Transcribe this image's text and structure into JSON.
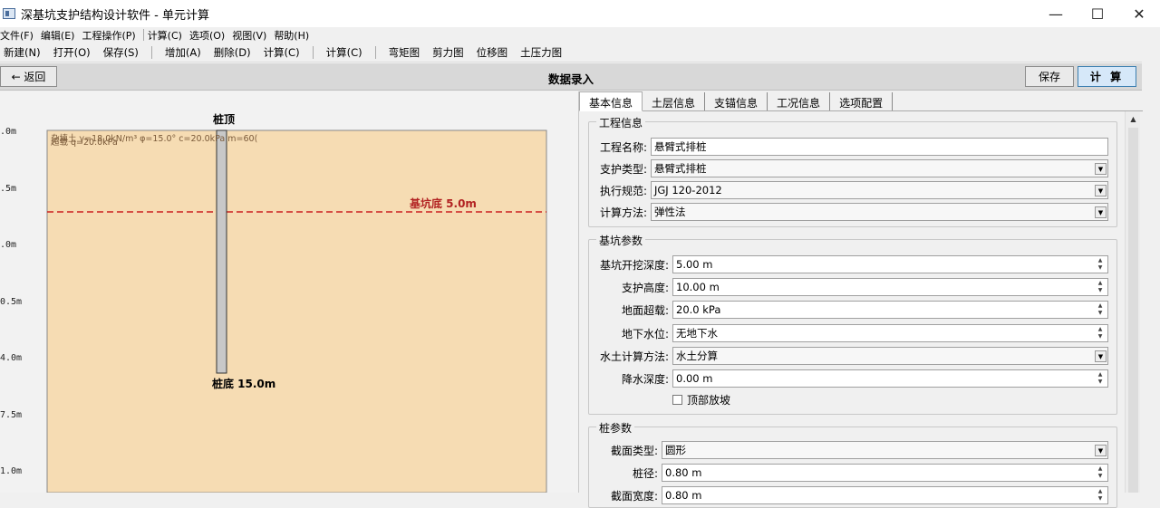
{
  "window": {
    "title": "深基坑支护结构设计软件 - 单元计算",
    "minimize": "—",
    "maximize": "☐",
    "close": "✕"
  },
  "menu": [
    "文件(F)",
    "编辑(E)",
    "工程操作(P)",
    "计算(C)",
    "选项(O)",
    "视图(V)",
    "帮助(H)"
  ],
  "toolbar": [
    "新建(N)",
    "打开(O)",
    "保存(S)",
    "增加(A)",
    "删除(D)",
    "计算(C)",
    "计算(C)",
    "弯矩图",
    "剪力图",
    "位移图",
    "土压力图"
  ],
  "header": {
    "back": "← 返回",
    "title": "数据录入",
    "save": "保存",
    "calc": "计 算"
  },
  "drawing": {
    "pile_top_label": "桩顶",
    "pile_bottom_label": "桩底 15.0m",
    "pit_bottom_label": "基坑底 5.0m",
    "soil_text_1": "杂填土  γ=18.0kN/m³   φ=15.0°   c=20.0kPa   m=60(",
    "soil_text_2": "超载 q=20.0kPa",
    "depth_labels": [
      ".0m",
      ".5m",
      ".0m",
      "0.5m",
      "4.0m",
      "7.5m",
      "1.0m"
    ],
    "colors": {
      "soil": "#f6dcb3",
      "pit_line": "#cc1f1f",
      "pile": "#c8c8c8"
    }
  },
  "tabs": [
    "基本信息",
    "土层信息",
    "支锚信息",
    "工况信息",
    "选项配置"
  ],
  "groups": {
    "project": {
      "title": "工程信息",
      "fields": [
        {
          "label": "工程名称:",
          "value": "悬臂式排桩"
        },
        {
          "label": "支护类型:",
          "value": "悬臂式排桩"
        },
        {
          "label": "执行规范:",
          "value": "JGJ 120-2012"
        },
        {
          "label": "计算方法:",
          "value": "弹性法"
        }
      ]
    },
    "pit": {
      "title": "基坑参数",
      "fields": [
        {
          "label": "基坑开挖深度:",
          "value": "5.00 m"
        },
        {
          "label": "支护高度:",
          "value": "10.00 m"
        },
        {
          "label": "地面超载:",
          "value": "20.0 kPa"
        },
        {
          "label": "地下水位:",
          "value": "无地下水"
        },
        {
          "label": "水土计算方法:",
          "value": "水土分算"
        },
        {
          "label": "降水深度:",
          "value": "0.00 m"
        }
      ],
      "checkbox": "顶部放坡"
    },
    "pile": {
      "title": "桩参数",
      "fields": [
        {
          "label": "截面类型:",
          "value": "圆形"
        },
        {
          "label": "桩径:",
          "value": "0.80 m"
        },
        {
          "label": "截面宽度:",
          "value": "0.80 m"
        }
      ]
    }
  }
}
